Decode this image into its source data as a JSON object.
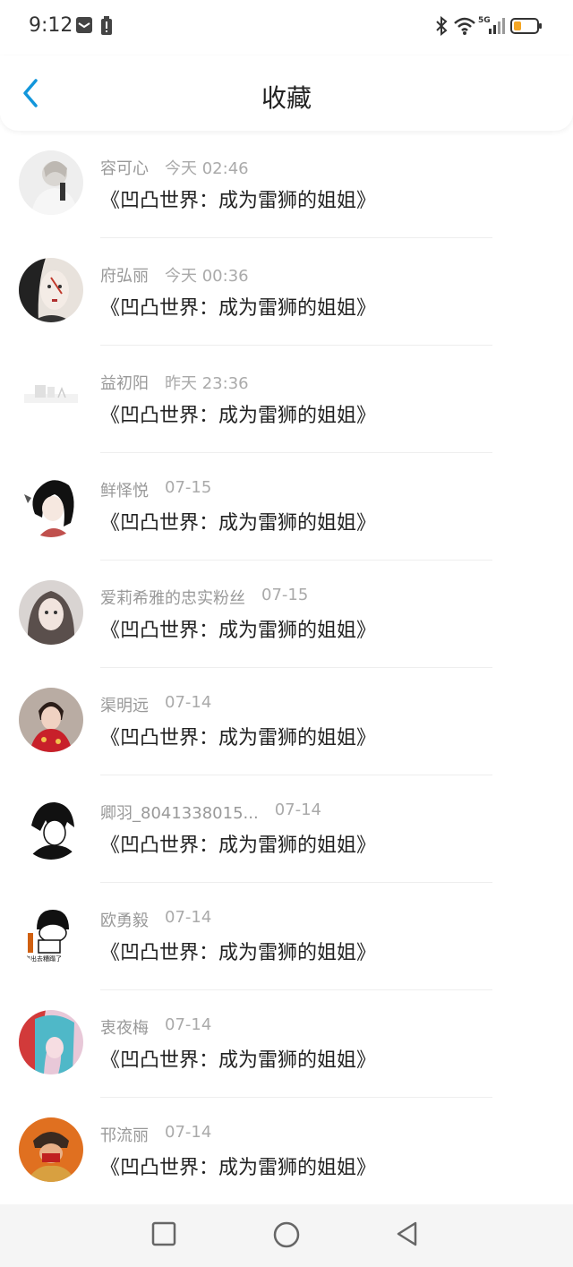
{
  "status_bar": {
    "time": "9:12",
    "network": "5G",
    "icons": [
      "message-icon",
      "alert-battery-icon",
      "bluetooth-icon",
      "wifi-icon",
      "signal-icon",
      "battery-icon"
    ]
  },
  "header": {
    "title": "收藏",
    "back_icon": "chevron-left-icon",
    "accent_color": "#1296db"
  },
  "items": [
    {
      "name": "容可心",
      "time": "今天 02:46",
      "title": "《凹凸世界：成为雷狮的姐姐》"
    },
    {
      "name": "府弘丽",
      "time": "今天 00:36",
      "title": "《凹凸世界：成为雷狮的姐姐》"
    },
    {
      "name": "益初阳",
      "time": "昨天 23:36",
      "title": "《凹凸世界：成为雷狮的姐姐》"
    },
    {
      "name": "鲜怿悦",
      "time": "07-15",
      "title": "《凹凸世界：成为雷狮的姐姐》"
    },
    {
      "name": "爱莉希雅的忠实粉丝",
      "time": "07-15",
      "title": "《凹凸世界：成为雷狮的姐姐》"
    },
    {
      "name": "渠明远",
      "time": "07-14",
      "title": "《凹凸世界：成为雷狮的姐姐》"
    },
    {
      "name": "卿羽_8041338015...",
      "time": "07-14",
      "title": "《凹凸世界：成为雷狮的姐姐》"
    },
    {
      "name": "欧勇毅",
      "time": "07-14",
      "title": "《凹凸世界：成为雷狮的姐姐》",
      "avatar_caption": "饱出去糟蹋了"
    },
    {
      "name": "衷夜梅",
      "time": "07-14",
      "title": "《凹凸世界：成为雷狮的姐姐》"
    },
    {
      "name": "邗流丽",
      "time": "07-14",
      "title": "《凹凸世界：成为雷狮的姐姐》"
    }
  ],
  "nav_bar": {
    "icons": [
      "recent-apps-square-icon",
      "home-circle-icon",
      "back-triangle-icon"
    ]
  }
}
